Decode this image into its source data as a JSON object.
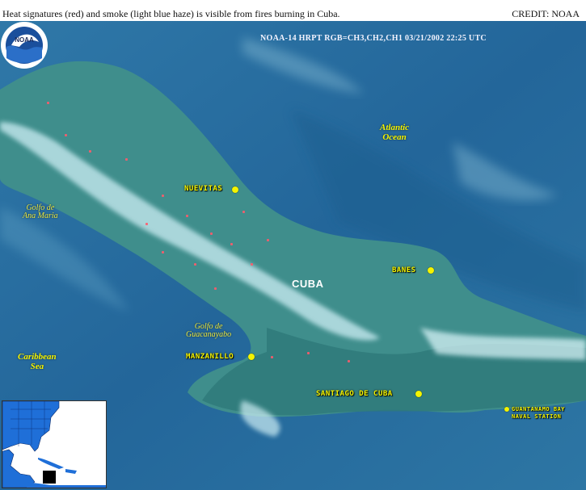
{
  "caption": "Heat signatures (red) and smoke (light blue haze) is visible from fires burning in Cuba.",
  "credit": "CREDIT: NOAA",
  "header": "NOAA-14  HRPT  RGB=CH3,CH2,CH1  03/21/2002  22:25 UTC",
  "logo": {
    "name": "noaa-logo",
    "text": "NOAA"
  },
  "country_label": "CUBA",
  "cities": [
    {
      "name": "Nuevitas"
    },
    {
      "name": "Banes"
    },
    {
      "name": "Manzanillo"
    },
    {
      "name": "Santiago de Cuba"
    },
    {
      "name": "Guantanamo Bay",
      "line2": "Naval Station"
    }
  ],
  "water_labels": [
    {
      "line1": "Golfo de",
      "line2": "Ana Maria"
    },
    {
      "line1": "Golfo de",
      "line2": "Guacanayabo"
    }
  ],
  "ocean_labels": [
    {
      "line1": "Atlantic",
      "line2": "Ocean"
    },
    {
      "line1": "Caribbean",
      "line2": "Sea"
    }
  ],
  "colors": {
    "sea": "#2a6e9e",
    "land": "#3f8e8c",
    "cloud": "#bfe8ee",
    "fire": "#ff5a6a",
    "city_label": "#f4f400"
  }
}
